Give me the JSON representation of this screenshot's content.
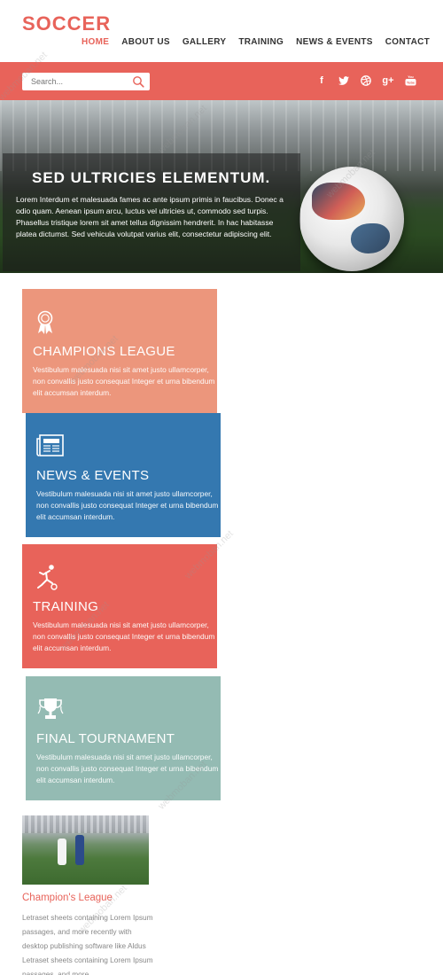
{
  "brand": {
    "logo": "SOCCER",
    "accent": "#e8635a"
  },
  "nav": [
    {
      "label": "HOME",
      "active": true
    },
    {
      "label": "ABOUT US",
      "active": false
    },
    {
      "label": "GALLERY",
      "active": false
    },
    {
      "label": "TRAINING",
      "active": false
    },
    {
      "label": "NEWS & EVENTS",
      "active": false
    },
    {
      "label": "CONTACT",
      "active": false
    }
  ],
  "search": {
    "placeholder": "Search..."
  },
  "socials": [
    "facebook-icon",
    "twitter-icon",
    "dribbble-icon",
    "google-plus-icon",
    "youtube-icon"
  ],
  "hero": {
    "title": "SED ULTRICIES ELEMENTUM.",
    "text": "Lorem Interdum et malesuada fames ac ante ipsum primis in faucibus. Donec a odio quam. Aenean ipsum arcu, luctus vel ultricies ut, commodo sed turpis. Phasellus tristique lorem sit amet tellus dignissim hendrerit. In hac habitasse platea dictumst. Sed vehicula volutpat varius elit, consectetur adipiscing elit."
  },
  "tiles": [
    {
      "title": "CHAMPIONS LEAGUE",
      "text": "Vestibulum malesuada nisi sit amet justo ullamcorper, non convallis justo consequat Integer et urna bibendum elit accumsan interdum.",
      "color": "#ec967c",
      "icon": "award-ribbon-icon"
    },
    {
      "title": "NEWS & EVENTS",
      "text": "Vestibulum malesuada nisi sit amet justo ullamcorper, non convallis justo consequat Integer et urna bibendum elit accumsan interdum.",
      "color": "#3478b0",
      "icon": "newspaper-icon"
    },
    {
      "title": "TRAINING",
      "text": "Vestibulum malesuada nisi sit amet justo ullamcorper, non convallis justo consequat Integer et urna bibendum elit accumsan interdum.",
      "color": "#e8635a",
      "icon": "player-kick-icon"
    },
    {
      "title": "FINAL TOURNAMENT",
      "text": "Vestibulum malesuada nisi sit amet justo ullamcorper, non convallis justo consequat Integer et urna bibendum elit accumsan interdum.",
      "color": "#94bbb3",
      "icon": "trophy-icon"
    }
  ],
  "article": {
    "title": "Champion's League",
    "text": "Letraset sheets containing Lorem Ipsum passages, and more recently with desktop publishing software like Aldus Letraset sheets containing Lorem Ipsum passages, and more"
  },
  "watermark": "webmoban.net"
}
